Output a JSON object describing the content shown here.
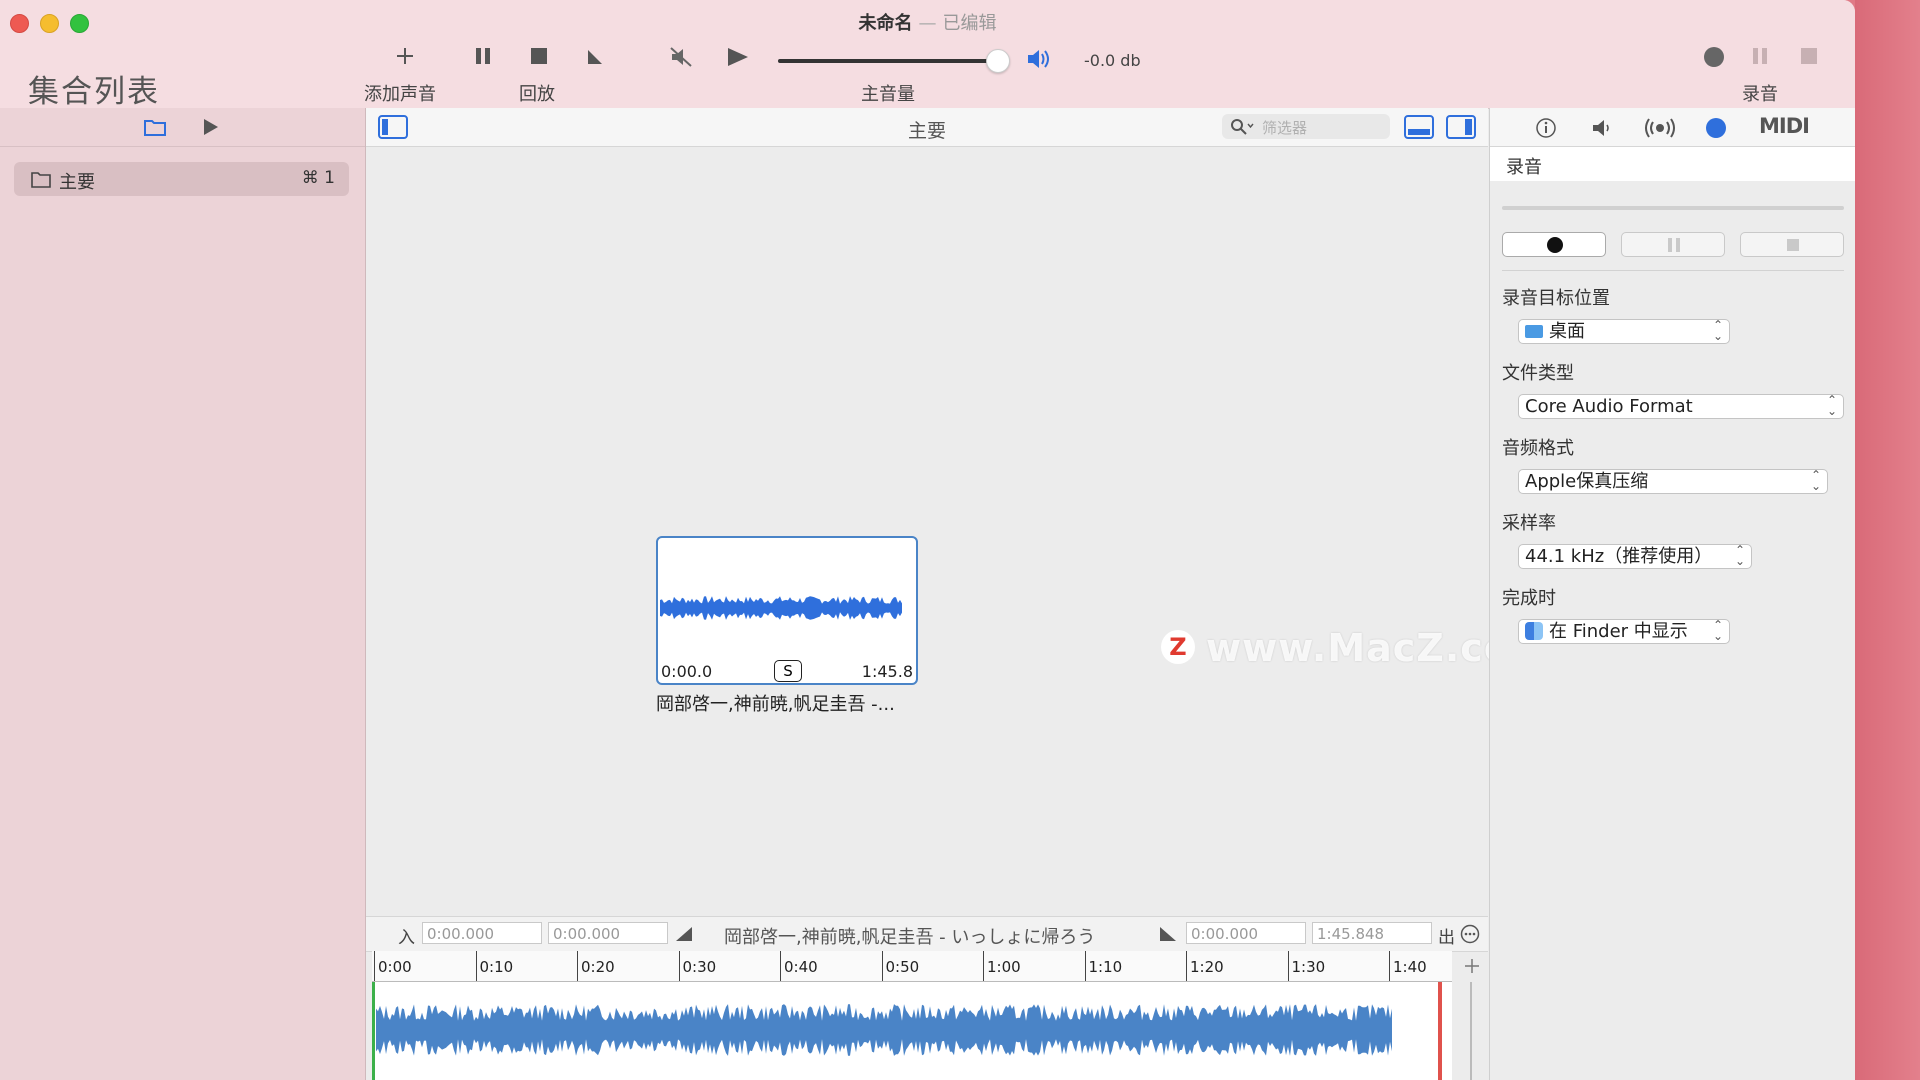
{
  "window": {
    "doc_title": "未命名",
    "separator": "—",
    "edited": "已编辑"
  },
  "library": {
    "title": "集合列表"
  },
  "toolbar": {
    "add_sound_label": "添加声音",
    "playback_label": "回放",
    "master_volume_label": "主音量",
    "record_label": "录音",
    "volume_db": "-0.0 db",
    "volume_level": 0.92
  },
  "sidebar": {
    "items": [
      {
        "label": "主要",
        "shortcut": "⌘ 1"
      }
    ]
  },
  "main": {
    "title": "主要",
    "filter_placeholder": "筛选器",
    "card": {
      "start": "0:00.0",
      "end": "1:45.8",
      "badge": "S",
      "name": "岡部啓一,神前暁,帆足圭吾 -..."
    },
    "watermark": "www.MacZ.com",
    "watermark_logo": "Z"
  },
  "editbar": {
    "in_label": "入",
    "in_time": "0:00.000",
    "fade_in_time": "0:00.000",
    "track_name": "岡部啓一,神前暁,帆足圭吾 - いっしょに帰ろう",
    "fade_out_time": "0:00.000",
    "out_time": "1:45.848",
    "out_label": "出"
  },
  "timeline": {
    "ticks": [
      "0:00",
      "0:10",
      "0:20",
      "0:30",
      "0:40",
      "0:50",
      "1:00",
      "1:10",
      "1:20",
      "1:30",
      "1:40"
    ]
  },
  "inspector": {
    "tabs": [
      "info-icon",
      "speaker-icon",
      "broadcast-icon",
      "record-dot-icon",
      "midi-icon"
    ],
    "midi_label": "MIDI",
    "section_title": "录音",
    "destination_label": "录音目标位置",
    "destination_value": "桌面",
    "filetype_label": "文件类型",
    "filetype_value": "Core Audio Format",
    "format_label": "音频格式",
    "format_value": "Apple保真压缩",
    "samplerate_label": "采样率",
    "samplerate_value": "44.1 kHz（推荐使用）",
    "oncomplete_label": "完成时",
    "oncomplete_value": "在 Finder 中显示"
  },
  "colors": {
    "accent": "#2f6fdc",
    "waveform": "#4a84c7",
    "toolbar_bg": "#f5dde1",
    "sidebar_bg": "#ecd3d7"
  }
}
